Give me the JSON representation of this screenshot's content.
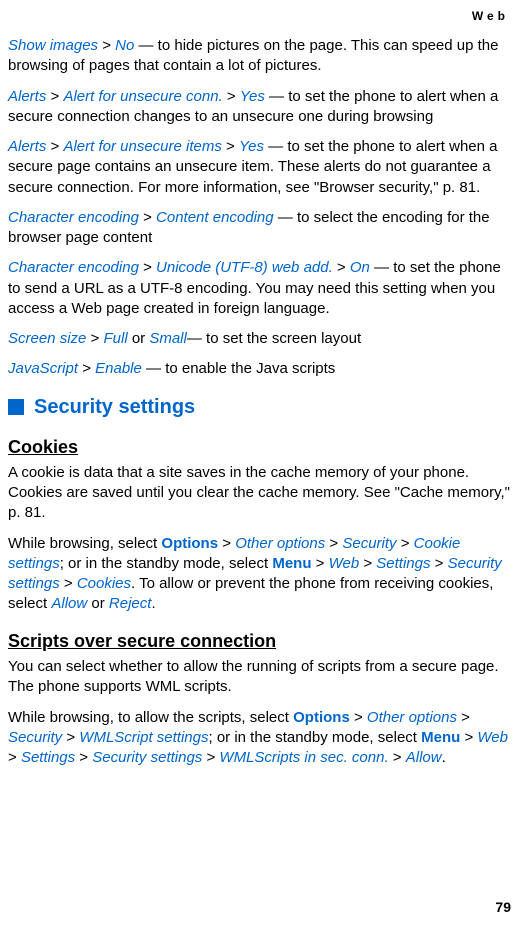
{
  "header": {
    "label": "Web"
  },
  "paragraphs": {
    "p1": {
      "link1": "Show images",
      "link2": "No",
      "tail": " — to hide pictures on the page. This can speed up the browsing of pages that contain a lot of pictures."
    },
    "p2": {
      "link1": "Alerts",
      "link2": "Alert for unsecure conn.",
      "link3": "Yes",
      "tail": " — to set the phone to alert when a secure connection changes to an unsecure one during browsing"
    },
    "p3": {
      "link1": "Alerts",
      "link2": "Alert for unsecure items",
      "link3": "Yes",
      "tail": " — to set the phone to alert when a secure page contains an unsecure item. These alerts do not guarantee a secure connection. For more information, see \"Browser security,\" p. 81."
    },
    "p4": {
      "link1": "Character encoding",
      "link2": "Content encoding",
      "tail": " — to select the encoding for the browser page content"
    },
    "p5": {
      "link1": "Character encoding",
      "link2": "Unicode (UTF-8) web add.",
      "link3": "On",
      "tail": " — to set the phone to send a URL as a UTF-8 encoding. You may need this setting when you access a Web page created in foreign language."
    },
    "p6": {
      "link1": "Screen size",
      "link2": "Full",
      "mid": " or ",
      "link3": "Small",
      "tail": "— to set the screen layout"
    },
    "p7": {
      "link1": "JavaScript",
      "link2": "Enable",
      "tail": " — to enable the Java scripts"
    }
  },
  "section": {
    "title": "Security settings"
  },
  "cookies": {
    "heading": "Cookies",
    "p1": "A cookie is data that a site saves in the cache memory of your phone. Cookies are saved until you clear the cache memory. See \"Cache memory,\" p. 81.",
    "p2": {
      "pre": "While browsing, select ",
      "options": "Options",
      "other_options": "Other options",
      "security": "Security",
      "cookie_settings": "Cookie settings",
      "mid1": "; or in the standby mode, select ",
      "menu": "Menu",
      "web": "Web",
      "settings": "Settings",
      "security_settings": "Security settings",
      "cookies": "Cookies",
      "mid2": ". To allow or prevent the phone from receiving cookies, select ",
      "allow": "Allow",
      "or": " or ",
      "reject": "Reject",
      "period": "."
    }
  },
  "scripts": {
    "heading": "Scripts over secure connection",
    "p1": "You can select whether to allow the running of scripts from a secure page. The phone supports WML scripts.",
    "p2": {
      "pre": "While browsing, to allow the scripts, select ",
      "options": "Options",
      "other_options": "Other options",
      "security": "Security",
      "wmlscript_settings": "WMLScript settings",
      "mid1": "; or in the standby mode, select ",
      "menu": "Menu",
      "web": "Web",
      "settings": "Settings",
      "security_settings": "Security settings",
      "wmlscripts_sec": "WMLScripts in sec. conn.",
      "allow": "Allow",
      "period": "."
    }
  },
  "page_number": "79",
  "gt": " > "
}
